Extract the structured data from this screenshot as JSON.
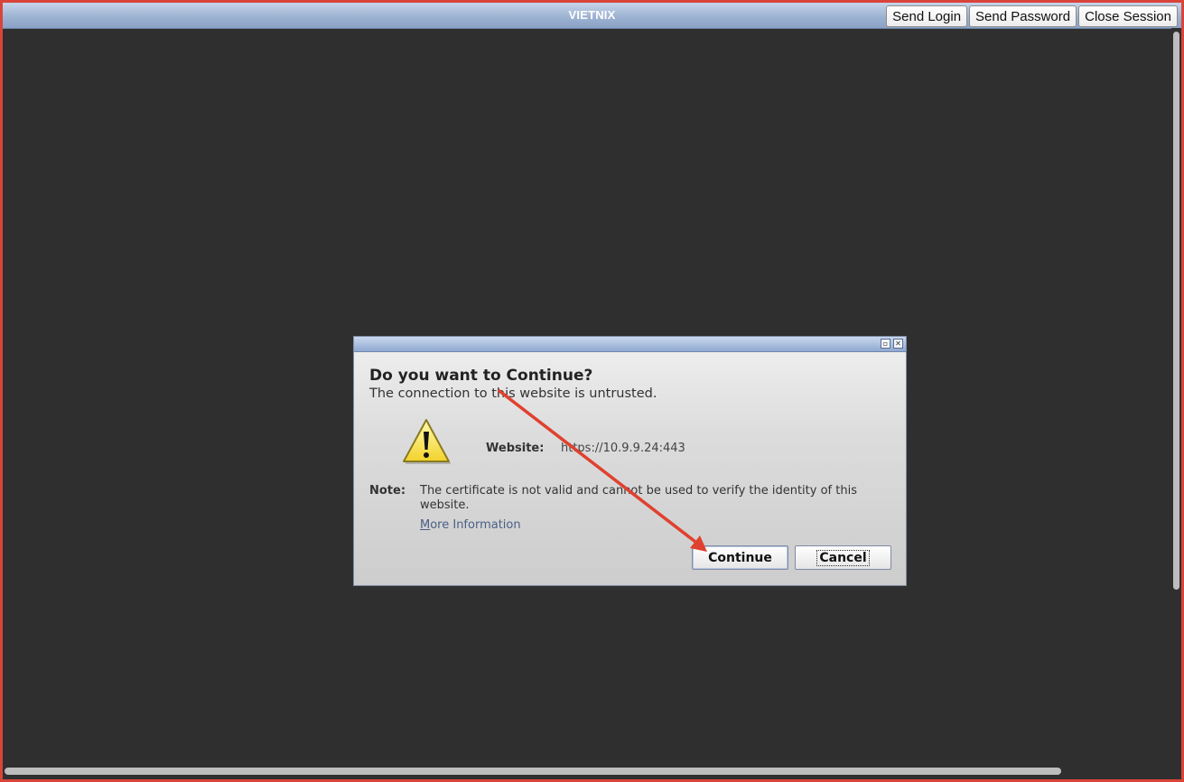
{
  "topbar": {
    "title": "VIETNIX",
    "buttons": [
      {
        "label": "Send Login"
      },
      {
        "label": "Send Password"
      },
      {
        "label": "Close Session"
      }
    ]
  },
  "dialog": {
    "titlebar_icons": [
      "restore-icon",
      "close-icon"
    ],
    "heading": "Do you want to Continue?",
    "subheading": "The connection to this website is untrusted.",
    "icon": "warning-icon",
    "website_label": "Website:",
    "website_value": "https://10.9.9.24:443",
    "note_label": "Note:",
    "note_text": "The certificate is not valid and cannot be used to verify the identity of this website.",
    "more_info_first": "M",
    "more_info_rest": "ore Information",
    "continue_label": "Continue",
    "cancel_label": "Cancel"
  },
  "annotation": {
    "type": "arrow",
    "color": "#e0412f",
    "target": "continue-button"
  },
  "colors": {
    "background": "#2f2f2f",
    "frame": "#d9443a",
    "titlebar": "#9eb3d2"
  }
}
